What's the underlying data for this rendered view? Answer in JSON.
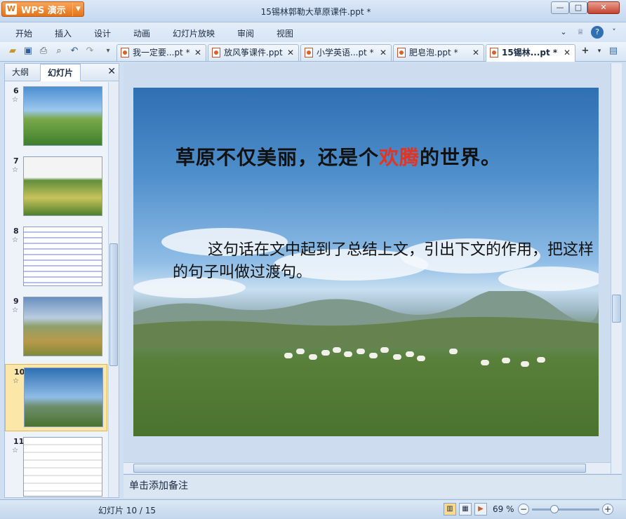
{
  "app": {
    "logo_label": "WPS 演示",
    "window_title": "15锡林郭勒大草原课件.ppt *"
  },
  "menu": {
    "items": [
      "开始",
      "插入",
      "设计",
      "动画",
      "幻灯片放映",
      "审阅",
      "视图"
    ]
  },
  "tabs": [
    {
      "label": "我一定要...pt *",
      "active": false
    },
    {
      "label": "放风筝课件.ppt",
      "active": false
    },
    {
      "label": "小学英语...pt *",
      "active": false
    },
    {
      "label": "肥皂泡.ppt *",
      "active": false
    },
    {
      "label": "15锡林...pt *",
      "active": true
    }
  ],
  "left_panel": {
    "tab_outline": "大纲",
    "tab_slides": "幻灯片",
    "thumbnails": [
      {
        "num": "6",
        "selected": false
      },
      {
        "num": "7",
        "selected": false
      },
      {
        "num": "8",
        "selected": false
      },
      {
        "num": "9",
        "selected": false
      },
      {
        "num": "10",
        "selected": true
      },
      {
        "num": "11",
        "selected": false
      }
    ]
  },
  "slide": {
    "heading_pre": "草原不仅美丽，还是个",
    "heading_highlight": "欢腾",
    "heading_post": "的世界。",
    "body": "这句话在文中起到了总结上文，引出下文的作用，把这样的句子叫做过渡句。",
    "highlight_color": "#e5331f"
  },
  "notes": {
    "placeholder": "单击添加备注"
  },
  "status": {
    "slide_counter": "幻灯片 10 / 15",
    "zoom": "69 %"
  },
  "icons": [
    "wps-logo-icon",
    "open-icon",
    "save-icon",
    "print-icon",
    "preview-icon",
    "undo-icon",
    "redo-icon",
    "new-tab-icon",
    "close-icon"
  ]
}
